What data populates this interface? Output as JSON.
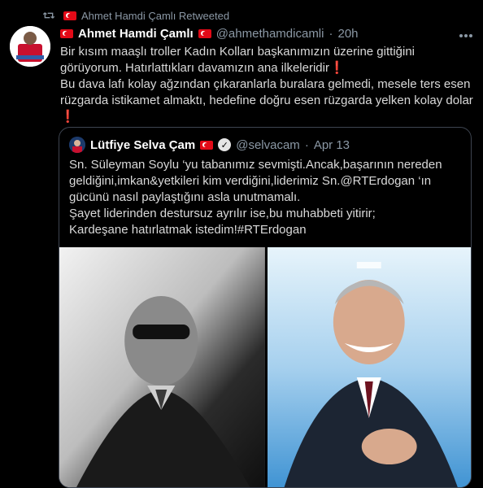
{
  "retweet": {
    "label": "Ahmet Hamdi Çamlı Retweeted"
  },
  "tweet": {
    "name": "Ahmet Hamdi Çamlı",
    "handle": "@ahmethamdicamli",
    "separator": "·",
    "time": "20h",
    "text_lines": [
      "Bir kısım maaşlı troller Kadın Kolları başkanımızın üzerine gittiğini görüyorum. Hatırlattıkları davamızın ana ilkeleridir",
      "Bu dava lafı kolay ağzından çıkaranlarla buralara gelmedi, mesele ters esen rüzgarda istikamet almaktı, hedefine doğru esen rüzgarda yelken kolay dolar"
    ],
    "exclamation": "❗"
  },
  "quote": {
    "name": "Lütfiye Selva Çam",
    "handle": "@selvacam",
    "separator": "·",
    "date": "Apr 13",
    "verified_glyph": "✓",
    "text_lines": [
      "Sn. Süleyman Soylu ‘yu tabanımız sevmişti.Ancak,başarının nereden geldiğini,imkan&yetkileri kim verdiğini,liderimiz Sn.@RTErdogan ‘ın gücünü nasıl paylaştığını asla unutmamalı.",
      "Şayet liderinden destursuz ayrılır ise,bu muhabbeti yitirir;",
      "Kardeşane hatırlatmak istedim!#RTErdogan"
    ]
  },
  "icons": {
    "retweet": "retweet-icon",
    "more": "more-icon",
    "verified": "verified-badge-icon",
    "flag": "turkish-flag-icon"
  },
  "colors": {
    "background": "#000000",
    "text": "#d9d9d9",
    "muted": "#8b98a5",
    "flag_red": "#e30a17",
    "exclamation_red": "#e0245e"
  }
}
